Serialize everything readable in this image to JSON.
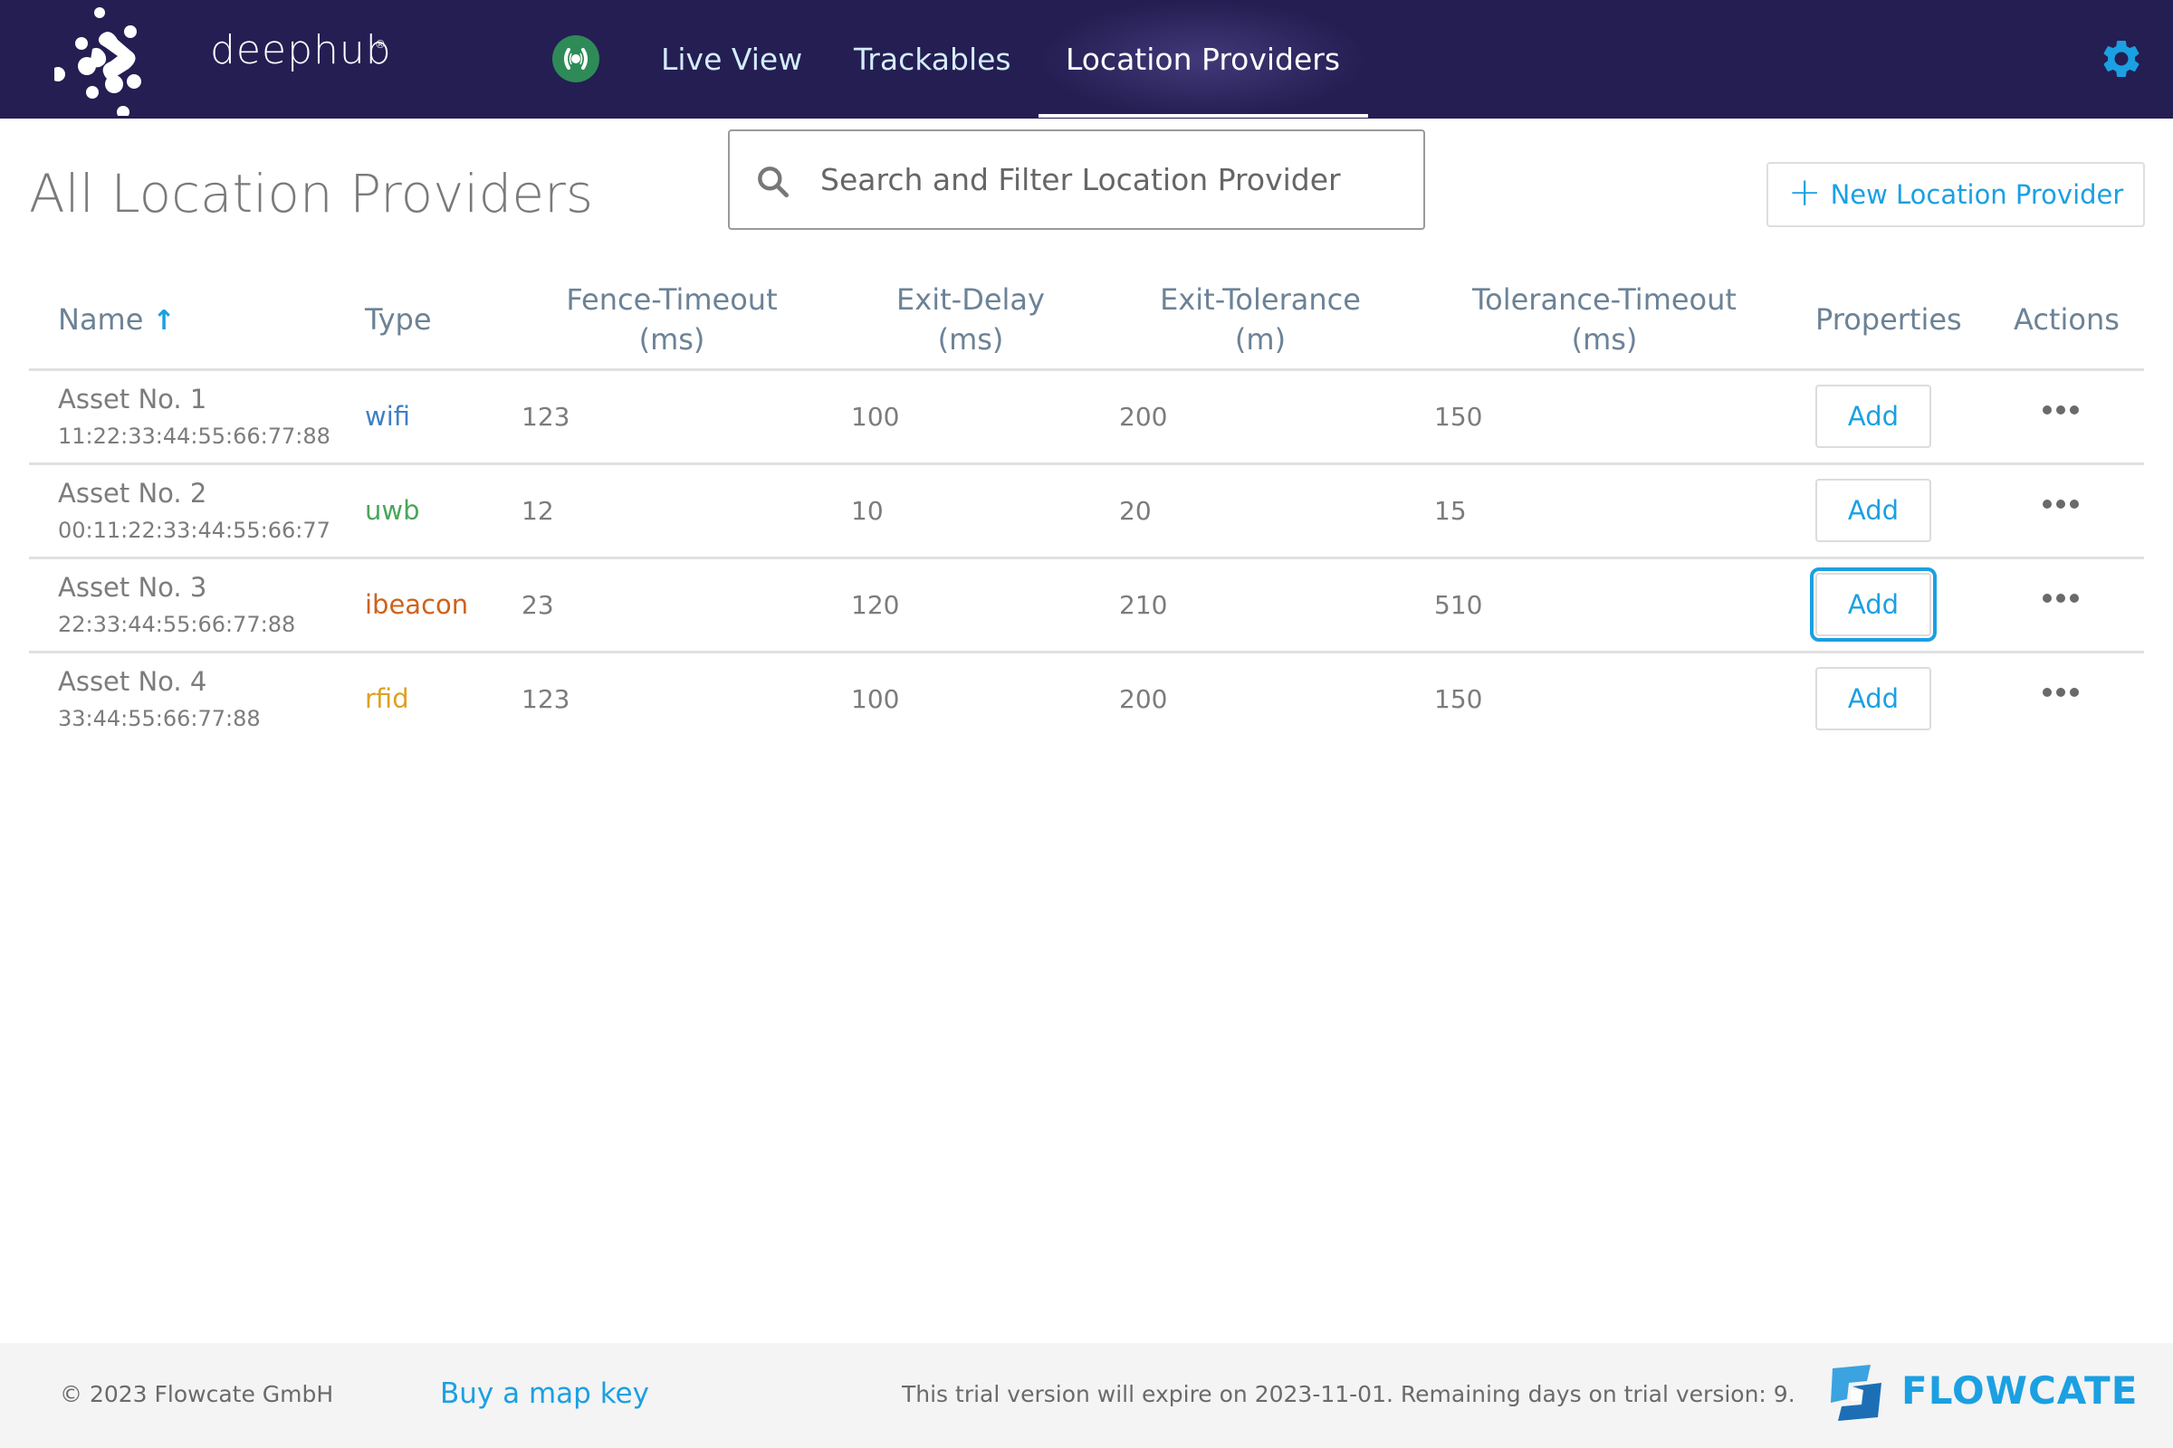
{
  "header": {
    "brand": "deephub",
    "brand_mark": "®",
    "status_icon": "broadcast-icon",
    "nav": [
      {
        "label": "Live View",
        "active": false
      },
      {
        "label": "Trackables",
        "active": false
      },
      {
        "label": "Location Providers",
        "active": true
      }
    ],
    "settings_icon": "gear-icon"
  },
  "page": {
    "title": "All Location Providers",
    "search_placeholder": "Search and Filter Location Provider",
    "search_value": "",
    "new_button_label": "New Location Provider"
  },
  "table": {
    "columns": [
      {
        "key": "name",
        "label": "Name",
        "sort": "asc"
      },
      {
        "key": "type",
        "label": "Type"
      },
      {
        "key": "fence_timeout",
        "label_line1": "Fence-Timeout",
        "label_line2": "(ms)"
      },
      {
        "key": "exit_delay",
        "label_line1": "Exit-Delay",
        "label_line2": "(ms)"
      },
      {
        "key": "exit_tolerance",
        "label_line1": "Exit-Tolerance",
        "label_line2": "(m)"
      },
      {
        "key": "tolerance_timeout",
        "label_line1": "Tolerance-Timeout",
        "label_line2": "(ms)"
      },
      {
        "key": "properties",
        "label": "Properties"
      },
      {
        "key": "actions",
        "label": "Actions"
      }
    ],
    "rows": [
      {
        "name": "Asset No. 1",
        "id": "11:22:33:44:55:66:77:88",
        "type": "wifi",
        "type_color": "#3f7fc1",
        "fence_timeout": "123",
        "exit_delay": "100",
        "exit_tolerance": "200",
        "tolerance_timeout": "150",
        "properties_label": "Add"
      },
      {
        "name": "Asset No. 2",
        "id": "00:11:22:33:44:55:66:77",
        "type": "uwb",
        "type_color": "#4aa55a",
        "fence_timeout": "12",
        "exit_delay": "10",
        "exit_tolerance": "20",
        "tolerance_timeout": "15",
        "properties_label": "Add"
      },
      {
        "name": "Asset No. 3",
        "id": "22:33:44:55:66:77:88",
        "type": "ibeacon",
        "type_color": "#d0621a",
        "fence_timeout": "23",
        "exit_delay": "120",
        "exit_tolerance": "210",
        "tolerance_timeout": "510",
        "properties_label": "Add"
      },
      {
        "name": "Asset No. 4",
        "id": "33:44:55:66:77:88",
        "type": "rfid",
        "type_color": "#e0a020",
        "fence_timeout": "123",
        "exit_delay": "100",
        "exit_tolerance": "200",
        "tolerance_timeout": "150",
        "properties_label": "Add"
      }
    ]
  },
  "footer": {
    "copyright": "© 2023 Flowcate GmbH",
    "buy_link": "Buy a map key",
    "trial_notice": "This trial version will expire on 2023-11-01. Remaining days on trial version: 9.",
    "company": "FLOWCATE"
  },
  "colors": {
    "header_bg": "#241e53",
    "accent": "#1ba0e2",
    "status_green": "#2e8b57"
  }
}
